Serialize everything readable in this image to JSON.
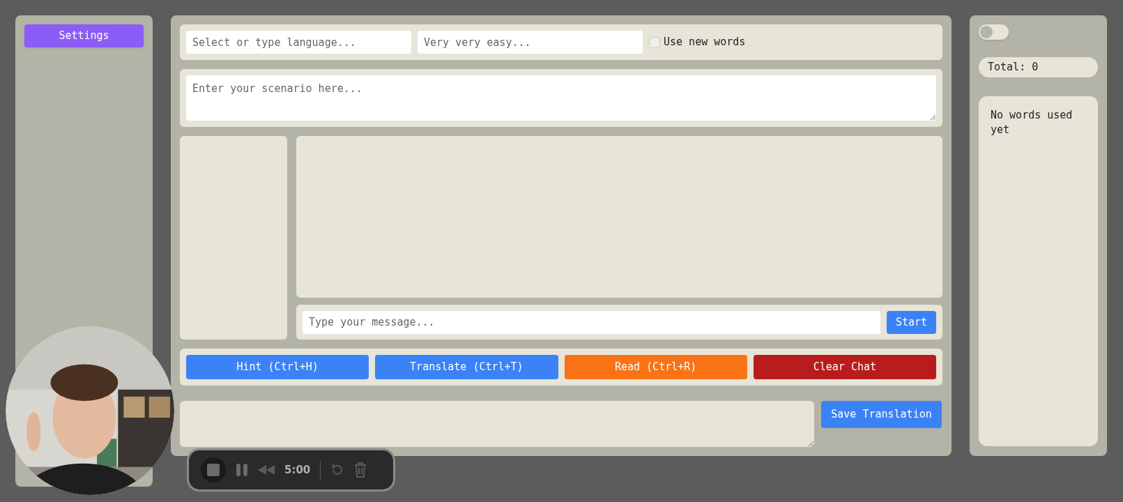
{
  "sidebar": {
    "settings_button": "Settings"
  },
  "options": {
    "language_placeholder": "Select or type language...",
    "level_placeholder": "Very very easy...",
    "use_new_words": {
      "label": "Use new words",
      "checked": false
    }
  },
  "scenario": {
    "placeholder": "Enter your scenario here..."
  },
  "chat": {
    "message_placeholder": "Type your message...",
    "send_button": "Start"
  },
  "actions": [
    {
      "label": "Hint (Ctrl+H)",
      "color": "#3b82f6"
    },
    {
      "label": "Translate (Ctrl+T)",
      "color": "#3b82f6"
    },
    {
      "label": "Read (Ctrl+R)",
      "color": "#f97316"
    },
    {
      "label": "Clear Chat",
      "color": "#b91c1c"
    }
  ],
  "translation": {
    "save_button": "Save Translation"
  },
  "words_panel": {
    "toggle_on": false,
    "total": "Total: 0",
    "empty_text": "No words used yet"
  },
  "recorder": {
    "time": "5:00"
  }
}
